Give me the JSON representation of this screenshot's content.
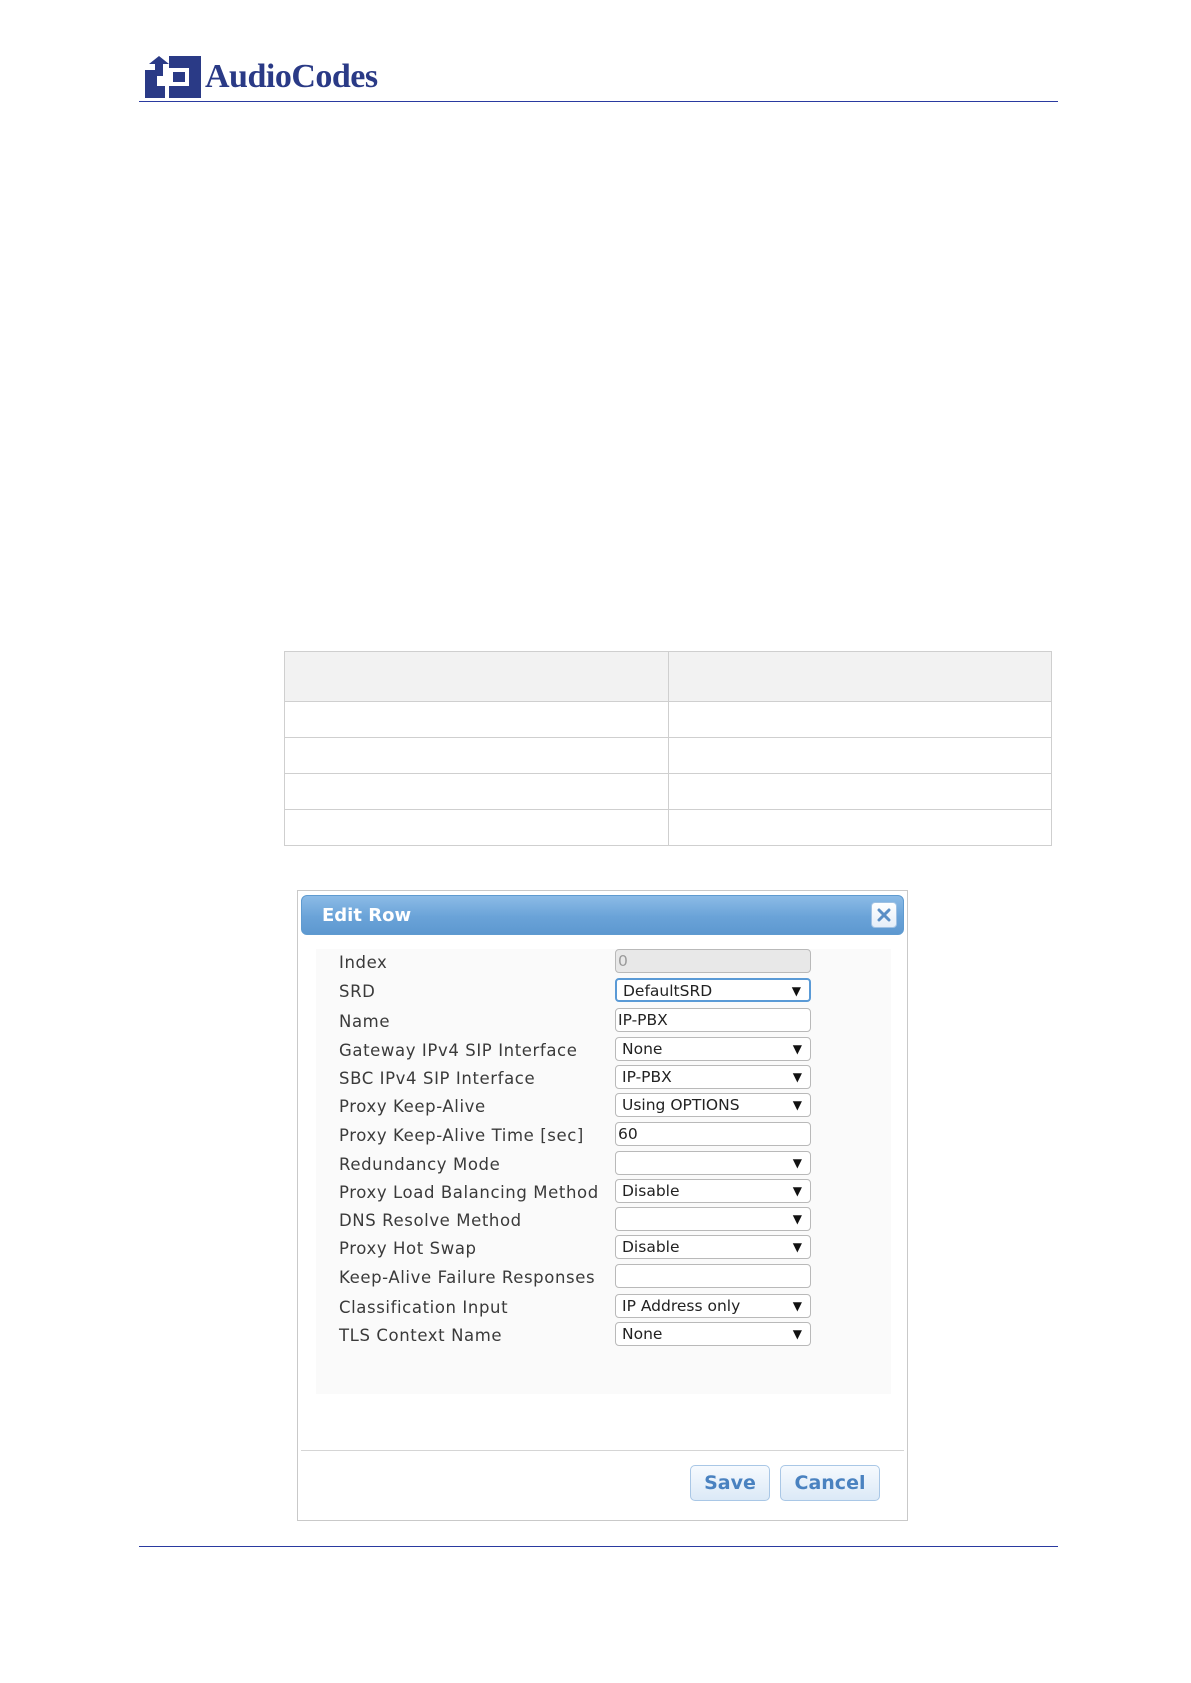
{
  "header": {
    "brand": "AudioCodes"
  },
  "dialog": {
    "title": "Edit Row",
    "fields": [
      {
        "label": "Index",
        "kind": "readonly",
        "value": "0"
      },
      {
        "label": "SRD",
        "kind": "select",
        "value": "DefaultSRD",
        "focused": true
      },
      {
        "label": "Name",
        "kind": "text",
        "value": "IP-PBX"
      },
      {
        "label": "Gateway IPv4 SIP Interface",
        "kind": "select",
        "value": "None"
      },
      {
        "label": "SBC IPv4 SIP Interface",
        "kind": "select",
        "value": "IP-PBX"
      },
      {
        "label": "Proxy Keep-Alive",
        "kind": "select",
        "value": "Using OPTIONS"
      },
      {
        "label": "Proxy Keep-Alive Time [sec]",
        "kind": "text",
        "value": "60"
      },
      {
        "label": "Redundancy Mode",
        "kind": "select",
        "value": ""
      },
      {
        "label": "Proxy Load Balancing Method",
        "kind": "select",
        "value": "Disable"
      },
      {
        "label": "DNS Resolve Method",
        "kind": "select",
        "value": ""
      },
      {
        "label": "Proxy Hot Swap",
        "kind": "select",
        "value": "Disable"
      },
      {
        "label": "Keep-Alive Failure Responses",
        "kind": "text",
        "value": ""
      },
      {
        "label": "Classification Input",
        "kind": "select",
        "value": "IP Address only"
      },
      {
        "label": "TLS Context Name",
        "kind": "select",
        "value": "None"
      }
    ],
    "save_label": "Save",
    "cancel_label": "Cancel"
  },
  "colors": {
    "brand": "#2a3a86",
    "titlebar": "#6aa3d8",
    "button_text": "#4a82c0"
  }
}
